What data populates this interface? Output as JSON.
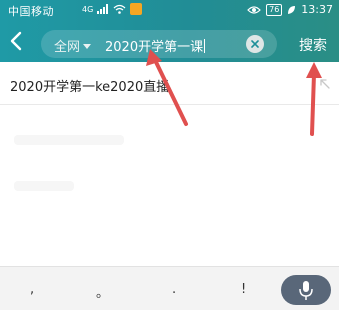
{
  "status_bar": {
    "carrier": "中国移动",
    "signal_label": "4G",
    "battery": "76",
    "time": "13:37"
  },
  "search": {
    "scope_label": "全网",
    "query": "2020开学第一课",
    "submit_label": "搜索"
  },
  "suggestions": [
    {
      "text": "2020开学第一ke2020直播"
    }
  ],
  "keyboard": {
    "keys": [
      ",",
      "。",
      ".",
      "!"
    ]
  },
  "colors": {
    "header_teal": "#1f9aa6",
    "annotation_red": "#e0504f",
    "mic_button": "#596779"
  },
  "icons": [
    "back-icon",
    "clear-icon",
    "fill-arrow-icon",
    "microphone-icon",
    "wifi-icon",
    "eye-icon"
  ]
}
